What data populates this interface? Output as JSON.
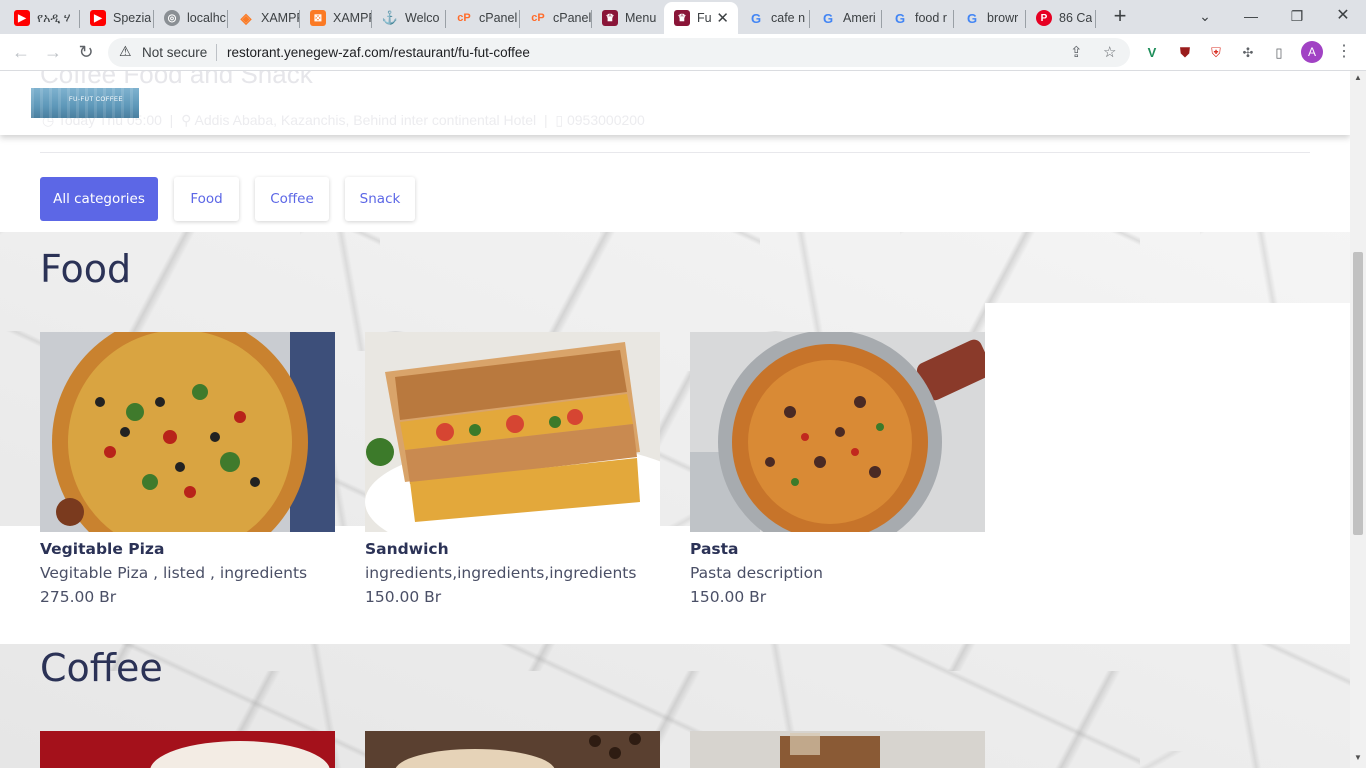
{
  "browser": {
    "tabs": [
      {
        "title": "የአዲ ሃ",
        "favicon": "youtube-icon",
        "color": "#ff0000"
      },
      {
        "title": "Spezia",
        "favicon": "youtube-icon",
        "color": "#ff0000"
      },
      {
        "title": "localhc",
        "favicon": "globe-icon",
        "color": "#5f6368"
      },
      {
        "title": "XAMPP",
        "favicon": "xampp-icon",
        "color": "#fb7a24"
      },
      {
        "title": "XAMPP",
        "favicon": "xampp-icon",
        "color": "#fb7a24"
      },
      {
        "title": "Welco",
        "favicon": "phpmyadmin-icon",
        "color": "#6c78af"
      },
      {
        "title": "cPanel",
        "favicon": "cpanel-icon",
        "color": "#ff6c2c"
      },
      {
        "title": "cPanel",
        "favicon": "cpanel-icon",
        "color": "#ff6c2c"
      },
      {
        "title": "Menu",
        "favicon": "restaurant-icon",
        "color": "#8a1538"
      },
      {
        "title": "Fu",
        "favicon": "restaurant-icon",
        "color": "#8a1538",
        "active": true
      },
      {
        "title": "cafe n",
        "favicon": "google-icon",
        "color": "#4285f4"
      },
      {
        "title": "Ameri",
        "favicon": "google-icon",
        "color": "#4285f4"
      },
      {
        "title": "food r",
        "favicon": "google-icon",
        "color": "#4285f4"
      },
      {
        "title": "browr",
        "favicon": "google-icon",
        "color": "#4285f4"
      },
      {
        "title": "86 Ca",
        "favicon": "pinterest-icon",
        "color": "#e60023"
      }
    ],
    "security": "Not secure",
    "url": "restorant.yenegew-zaf.com/restaurant/fu-fut-coffee",
    "profile_initial": "A"
  },
  "header": {
    "restaurant_title": "Coffee Food and Snack",
    "hours": "Today  Thu 05:00",
    "address": "Addis Ababa, Kazanchis, Behind inter continental Hotel",
    "phone": "0953000200",
    "logo_text": "FU-FUT COFFEE"
  },
  "categories": {
    "items": [
      "All categories",
      "Food",
      "Coffee",
      "Snack"
    ],
    "active": "All categories",
    "accent": "#5c67e6"
  },
  "sections": [
    {
      "title": "Food",
      "items": [
        {
          "name": "Vegitable Piza",
          "description": "Vegitable Piza , listed , ingredients",
          "price": "275.00 Br"
        },
        {
          "name": "Sandwich",
          "description": "ingredients,ingredients,ingredients",
          "price": "150.00 Br"
        },
        {
          "name": "Pasta",
          "description": "Pasta description",
          "price": "150.00 Br"
        }
      ]
    },
    {
      "title": "Coffee",
      "items": []
    }
  ]
}
